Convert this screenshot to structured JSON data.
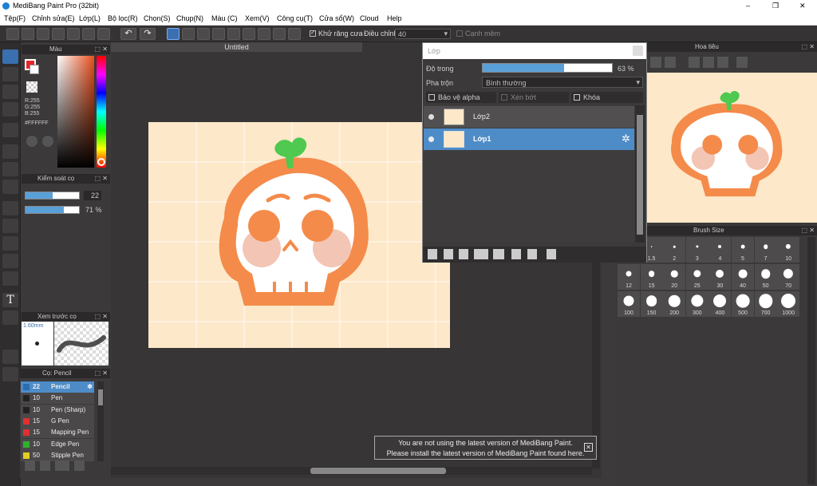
{
  "window": {
    "title": "MediBang Paint Pro (32bit)",
    "controls": [
      "–",
      "❐",
      "✕"
    ]
  },
  "menu": [
    "Tệp(F)",
    "Chỉnh sửa(E)",
    "Lớp(L)",
    "Bộ lọc(R)",
    "Chọn(S)",
    "Chụp(N)",
    "Màu (C)",
    "Xem(V)",
    "Công cụ(T)",
    "Cửa sổ(W)",
    "Cloud",
    "Help"
  ],
  "toolbar": {
    "antialias_label": "Khử răng cưa",
    "correction_label": "Điều chỉnh",
    "correction_value": "40",
    "soft_edge_label": "Cạnh mềm"
  },
  "color_panel": {
    "title": "Màu",
    "r": "R:255",
    "g": "G:255",
    "b": "B:255",
    "hex": "#FFFFFF",
    "primary": "#e5262b",
    "secondary": "#ffffff"
  },
  "brush_control": {
    "title": "Kiểm soát cọ",
    "size": "22",
    "opacity": "71 %",
    "size_fraction": 0.5,
    "opacity_fraction": 0.71
  },
  "preview": {
    "title": "Xem trước cọ",
    "size_label": "1.60mm"
  },
  "brush_list": {
    "title": "Cọ: Pencil",
    "items": [
      {
        "size": "22",
        "name": "Pencil",
        "color": "#2a6db0",
        "selected": true
      },
      {
        "size": "10",
        "name": "Pen",
        "color": "#222222",
        "selected": false
      },
      {
        "size": "10",
        "name": "Pen (Sharp)",
        "color": "#222222",
        "selected": false
      },
      {
        "size": "15",
        "name": "G Pen",
        "color": "#e03030",
        "selected": false
      },
      {
        "size": "15",
        "name": "Mapping Pen",
        "color": "#e03030",
        "selected": false
      },
      {
        "size": "10",
        "name": "Edge Pen",
        "color": "#30b030",
        "selected": false
      },
      {
        "size": "50",
        "name": "Stipple Pen",
        "color": "#e0d020",
        "selected": false
      }
    ]
  },
  "canvas": {
    "tab": "Untitled"
  },
  "notification": {
    "line1": "You are not using the latest version of MediBang Paint.",
    "line2": "Please install the latest version of MediBang Paint found here."
  },
  "layer_panel": {
    "title": "Lớp",
    "opacity_label": "Độ trong",
    "opacity_value": "63 %",
    "opacity_fraction": 0.63,
    "blend_label": "Pha trộn",
    "blend_value": "Bình thường",
    "protect_alpha": "Bảo vệ alpha",
    "clipping": "Xén bớt",
    "lock": "Khóa",
    "layers": [
      {
        "name": "Lớp2",
        "selected": false
      },
      {
        "name": "Lớp1",
        "selected": true
      }
    ]
  },
  "navigator": {
    "title": "Hoa tiêu"
  },
  "brush_size": {
    "title": "Brush Size",
    "sizes": [
      "1",
      "1.5",
      "2",
      "3",
      "4",
      "5",
      "7",
      "10",
      "12",
      "15",
      "20",
      "25",
      "30",
      "40",
      "50",
      "70",
      "100",
      "150",
      "200",
      "300",
      "400",
      "500",
      "700",
      "1000"
    ]
  }
}
